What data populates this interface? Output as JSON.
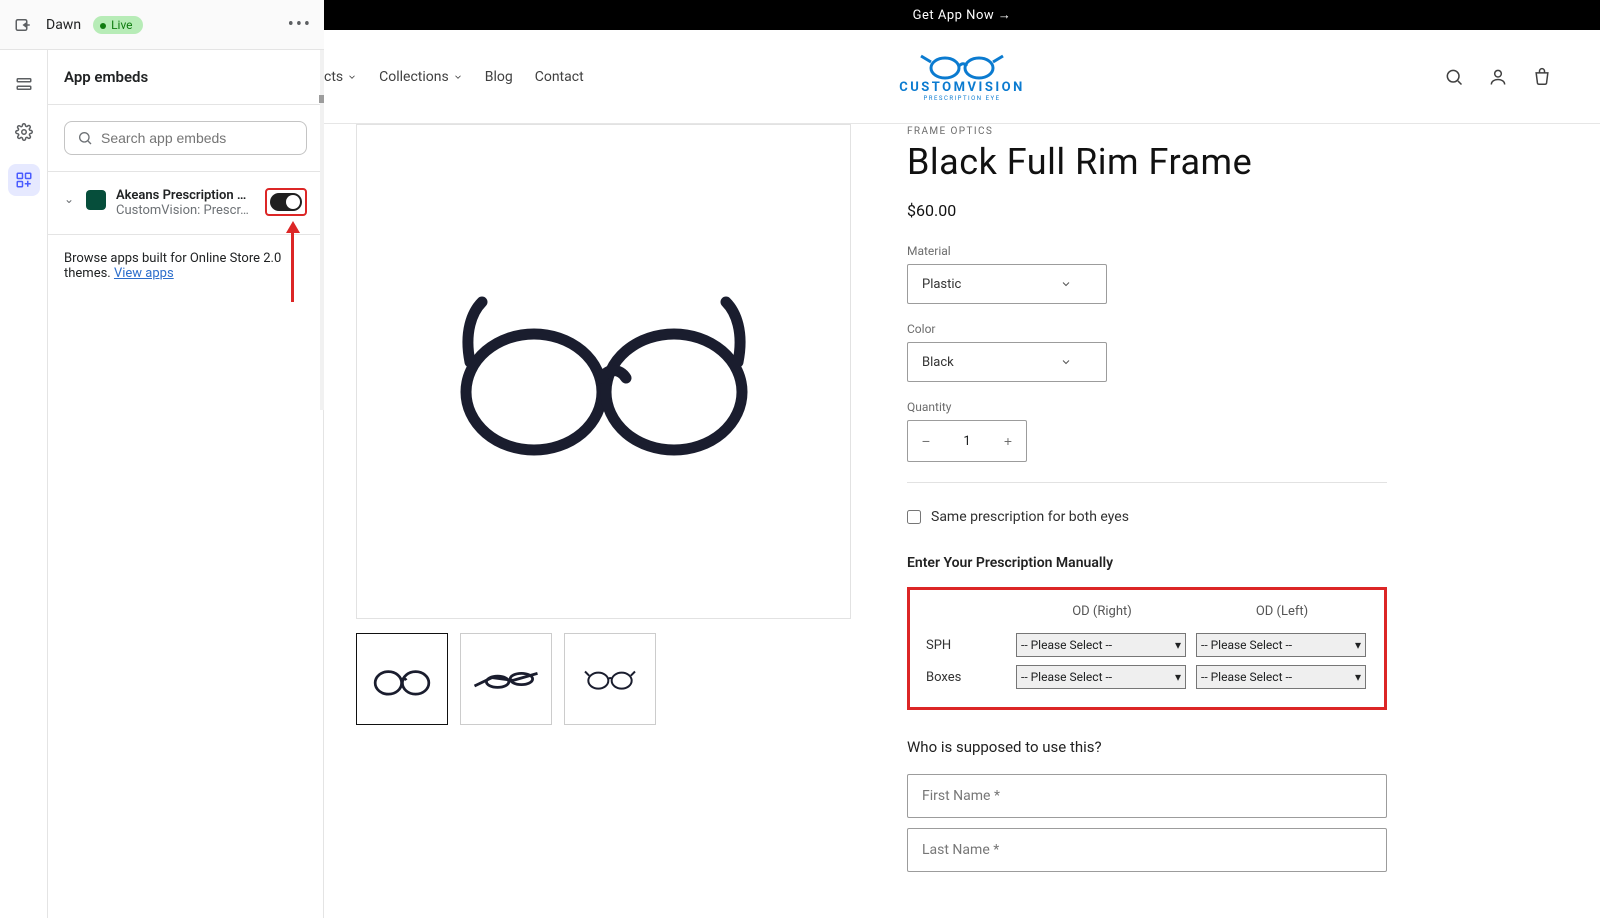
{
  "editor": {
    "theme_name": "Dawn",
    "status_label": "Live",
    "panel_title": "App embeds",
    "search_placeholder": "Search app embeds",
    "app": {
      "title": "Akeans Prescription …",
      "subtitle": "CustomVision: Prescr…"
    },
    "browse_text": "Browse apps built for Online Store 2.0 themes. ",
    "browse_link": "View apps"
  },
  "store": {
    "announcement": "Get App Now →",
    "nav": {
      "item_products": "cts",
      "item_collections": "Collections",
      "item_blog": "Blog",
      "item_contact": "Contact"
    },
    "logo_main": "CUSTOMVISION",
    "logo_sub": "PRESCRIPTION EYE"
  },
  "product": {
    "vendor": "FRAME OPTICS",
    "title": "Black Full Rim Frame",
    "price": "$60.00",
    "option_material_label": "Material",
    "option_material_value": "Plastic",
    "option_color_label": "Color",
    "option_color_value": "Black",
    "quantity_label": "Quantity",
    "quantity_value": "1",
    "same_rx_label": "Same prescription for both eyes",
    "manual_header": "Enter Your Prescription Manually",
    "rx": {
      "col_right": "OD (Right)",
      "col_left": "OD (Left)",
      "row_sph": "SPH",
      "row_boxes": "Boxes",
      "placeholder": "-- Please Select --"
    },
    "who_header": "Who is supposed to use this?",
    "first_name_ph": "First Name *",
    "last_name_ph": "Last Name *"
  }
}
